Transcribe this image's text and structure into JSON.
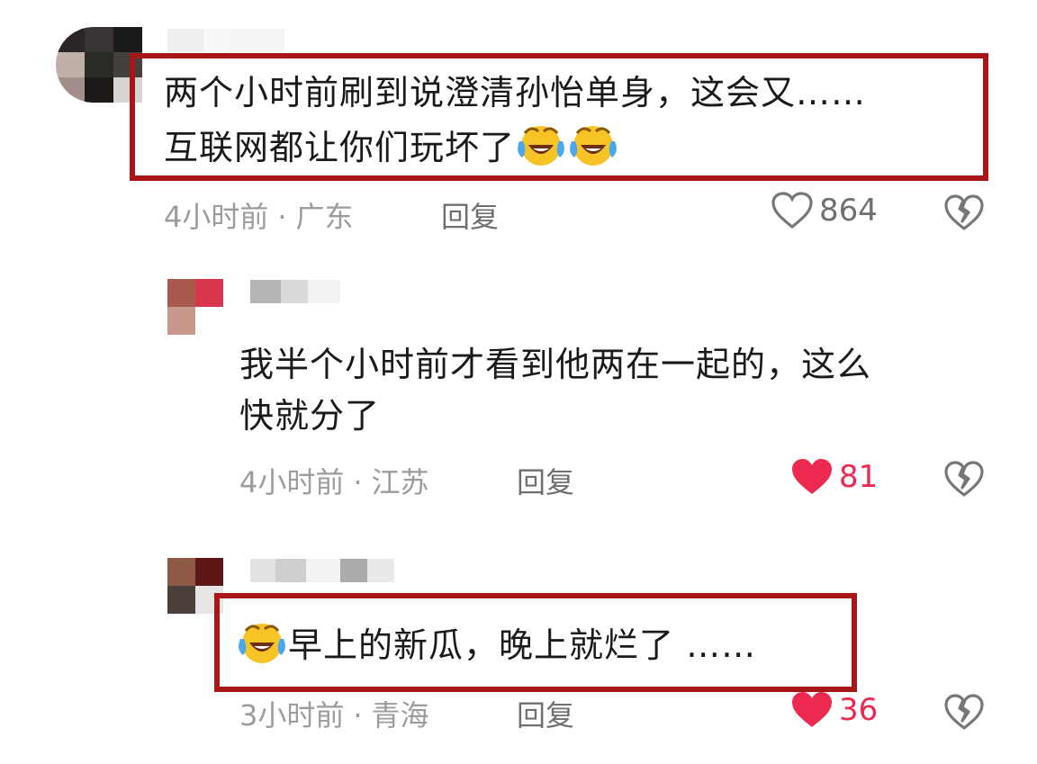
{
  "colors": {
    "highlight_box": "#a81717",
    "liked_heart": "#ee2950",
    "meta_text": "#9c9c9c",
    "body_text": "#1a1a1a"
  },
  "comments": [
    {
      "text_line1": "两个小时前刷到说澄清孙怡单身，这会又……",
      "text_line2": "互联网都让你们玩坏了",
      "emoji": "laugh-cry-emoji",
      "time": "4小时前",
      "location": "广东",
      "reply_label": "回复",
      "likes": "864",
      "liked": false
    },
    {
      "text_line1": "我半个小时前才看到他两在一起的，这么",
      "text_line2": "快就分了",
      "time": "4小时前",
      "location": "江苏",
      "reply_label": "回复",
      "likes": "81",
      "liked": true
    },
    {
      "text_line1": "早上的新瓜，晚上就烂了 ……",
      "emoji": "laugh-cry-emoji",
      "time": "3小时前",
      "location": "青海",
      "reply_label": "回复",
      "likes": "36",
      "liked": true
    }
  ]
}
